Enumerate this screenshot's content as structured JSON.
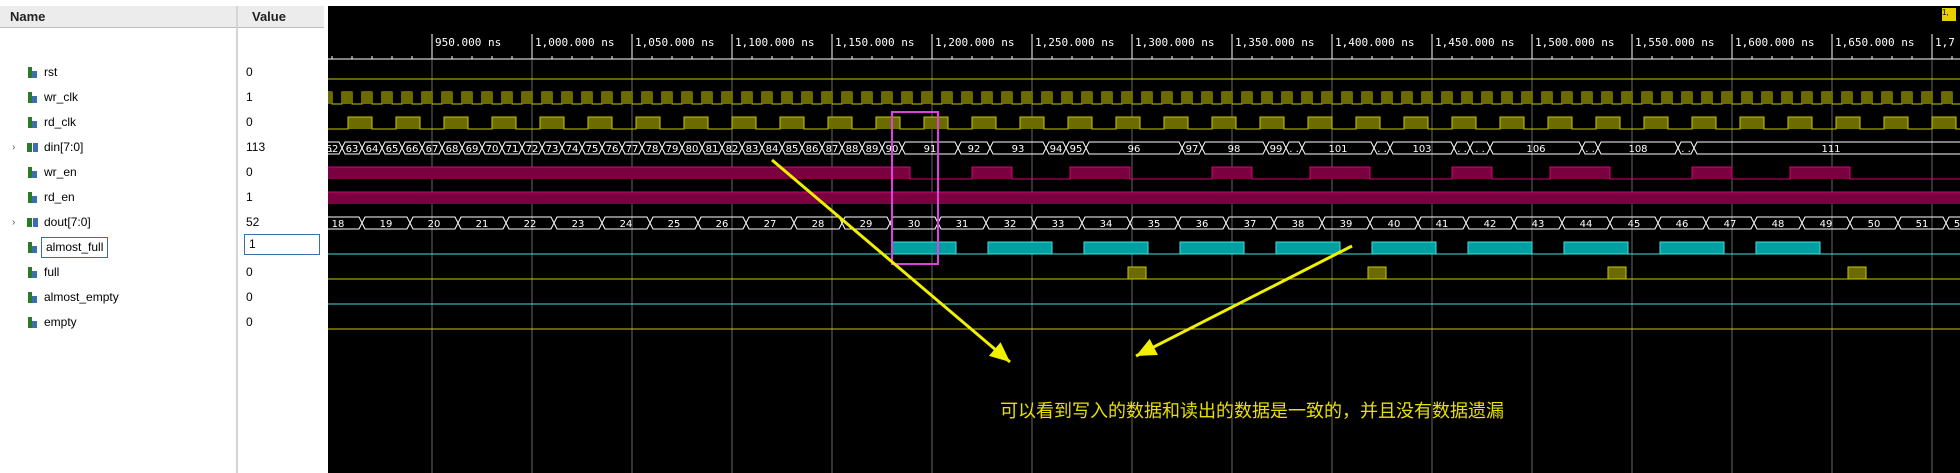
{
  "headers": {
    "name": "Name",
    "value": "Value"
  },
  "signals": [
    {
      "name": "rst",
      "value": "0",
      "bus": false
    },
    {
      "name": "wr_clk",
      "value": "1",
      "bus": false
    },
    {
      "name": "rd_clk",
      "value": "0",
      "bus": false
    },
    {
      "name": "din[7:0]",
      "value": "113",
      "bus": true
    },
    {
      "name": "wr_en",
      "value": "0",
      "bus": false
    },
    {
      "name": "rd_en",
      "value": "1",
      "bus": false
    },
    {
      "name": "dout[7:0]",
      "value": "52",
      "bus": true
    },
    {
      "name": "almost_full",
      "value": "1",
      "bus": false
    },
    {
      "name": "full",
      "value": "0",
      "bus": false
    },
    {
      "name": "almost_empty",
      "value": "0",
      "bus": false
    },
    {
      "name": "empty",
      "value": "0",
      "bus": false
    }
  ],
  "timeline": {
    "ticks": [
      "950.000 ns",
      "1,000.000 ns",
      "1,050.000 ns",
      "1,100.000 ns",
      "1,150.000 ns",
      "1,200.000 ns",
      "1,250.000 ns",
      "1,300.000 ns",
      "1,350.000 ns",
      "1,400.000 ns",
      "1,450.000 ns",
      "1,500.000 ns",
      "1,550.000 ns",
      "1,600.000 ns",
      "1,650.000 ns",
      "1,7"
    ],
    "badge": "1,"
  },
  "din_values": [
    "62",
    "63",
    "64",
    "65",
    "66",
    "67",
    "68",
    "69",
    "70",
    "71",
    "72",
    "73",
    "74",
    "75",
    "76",
    "77",
    "78",
    "79",
    "80",
    "81",
    "82",
    "83",
    "84",
    "85",
    "86",
    "87",
    "88",
    "89",
    "90",
    "91",
    "92",
    "93",
    "94",
    "95",
    "96",
    "97",
    "98",
    "99",
    ". .",
    "101",
    ". .",
    "103",
    ". .",
    ". .",
    "106",
    ". .",
    "108",
    ". .",
    "111",
    ". ."
  ],
  "dout_values": [
    "18",
    "19",
    "20",
    "21",
    "22",
    "23",
    "24",
    "25",
    "26",
    "27",
    "28",
    "29",
    "30",
    "31",
    "32",
    "33",
    "34",
    "35",
    "36",
    "37",
    "38",
    "39",
    "40",
    "41",
    "42",
    "43",
    "44",
    "45",
    "46",
    "47",
    "48",
    "49",
    "50",
    "51",
    "5"
  ],
  "annotation": "可以看到写入的数据和读出的数据是一致的，并且没有数据遗漏",
  "colors": {
    "clock": "#6b6b00",
    "clock_line": "#c8c800",
    "enable": "#7a0040",
    "enable_line": "#d8007a",
    "flag": "#00a0a0",
    "flag_line": "#3fe0e0",
    "bus": "#ffffff",
    "highlight": "#e040e0",
    "arrow": "#f0f000"
  }
}
